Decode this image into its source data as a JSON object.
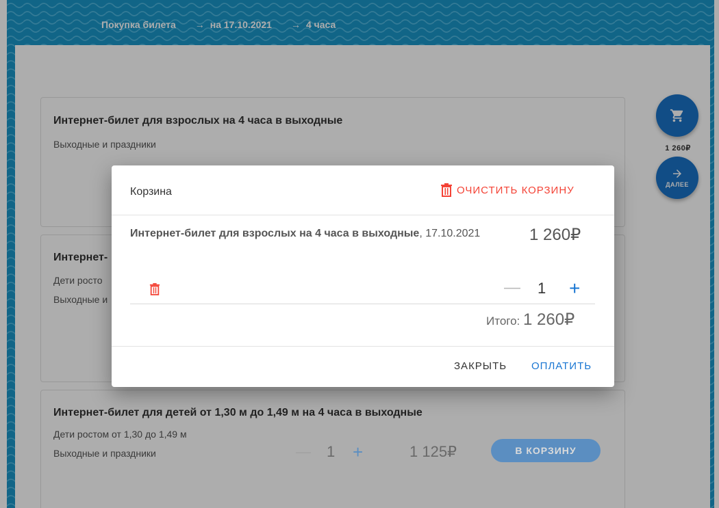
{
  "breadcrumb": {
    "items": [
      "Покупка билета",
      "на 17.10.2021",
      "4 часа"
    ],
    "arrow": "→"
  },
  "tickets": [
    {
      "title": "Интернет-билет для взрослых на 4 часа в выходные",
      "lines": [
        "Выходные и праздники"
      ]
    },
    {
      "title": "Интернет-",
      "lines": [
        "Дети росто",
        "Выходные и"
      ]
    },
    {
      "title": "Интернет-билет для детей от 1,30 м до 1,49 м на 4 часа в выходные",
      "lines": [
        "Дети ростом от 1,30 до 1,49 м",
        "Выходные и праздники"
      ],
      "minus": "—",
      "quantity": "1",
      "plus": "+",
      "price": "1 125₽",
      "add_button": "В КОРЗИНУ"
    }
  ],
  "side": {
    "cart_total": "1 260₽",
    "next_label": "ДАЛЕЕ"
  },
  "dialog": {
    "title": "Корзина",
    "clear_label": "ОЧИСТИТЬ КОРЗИНУ",
    "item": {
      "name": "Интернет-билет для взрослых на 4 часа в выходные",
      "date": ", 17.10.2021",
      "price": "1 260₽",
      "minus": "—",
      "quantity": "1",
      "plus": "+"
    },
    "total_label": "Итого: ",
    "total_value": "1 260₽",
    "close_label": "ЗАКРЫТЬ",
    "pay_label": "ОПЛАТИТЬ"
  },
  "colors": {
    "header": "#1a96c8",
    "accent": "#1976d2",
    "danger": "#f44336"
  },
  "icons": {
    "cart": "cart-icon",
    "next": "arrow-right-icon",
    "trash": "trash-icon"
  }
}
